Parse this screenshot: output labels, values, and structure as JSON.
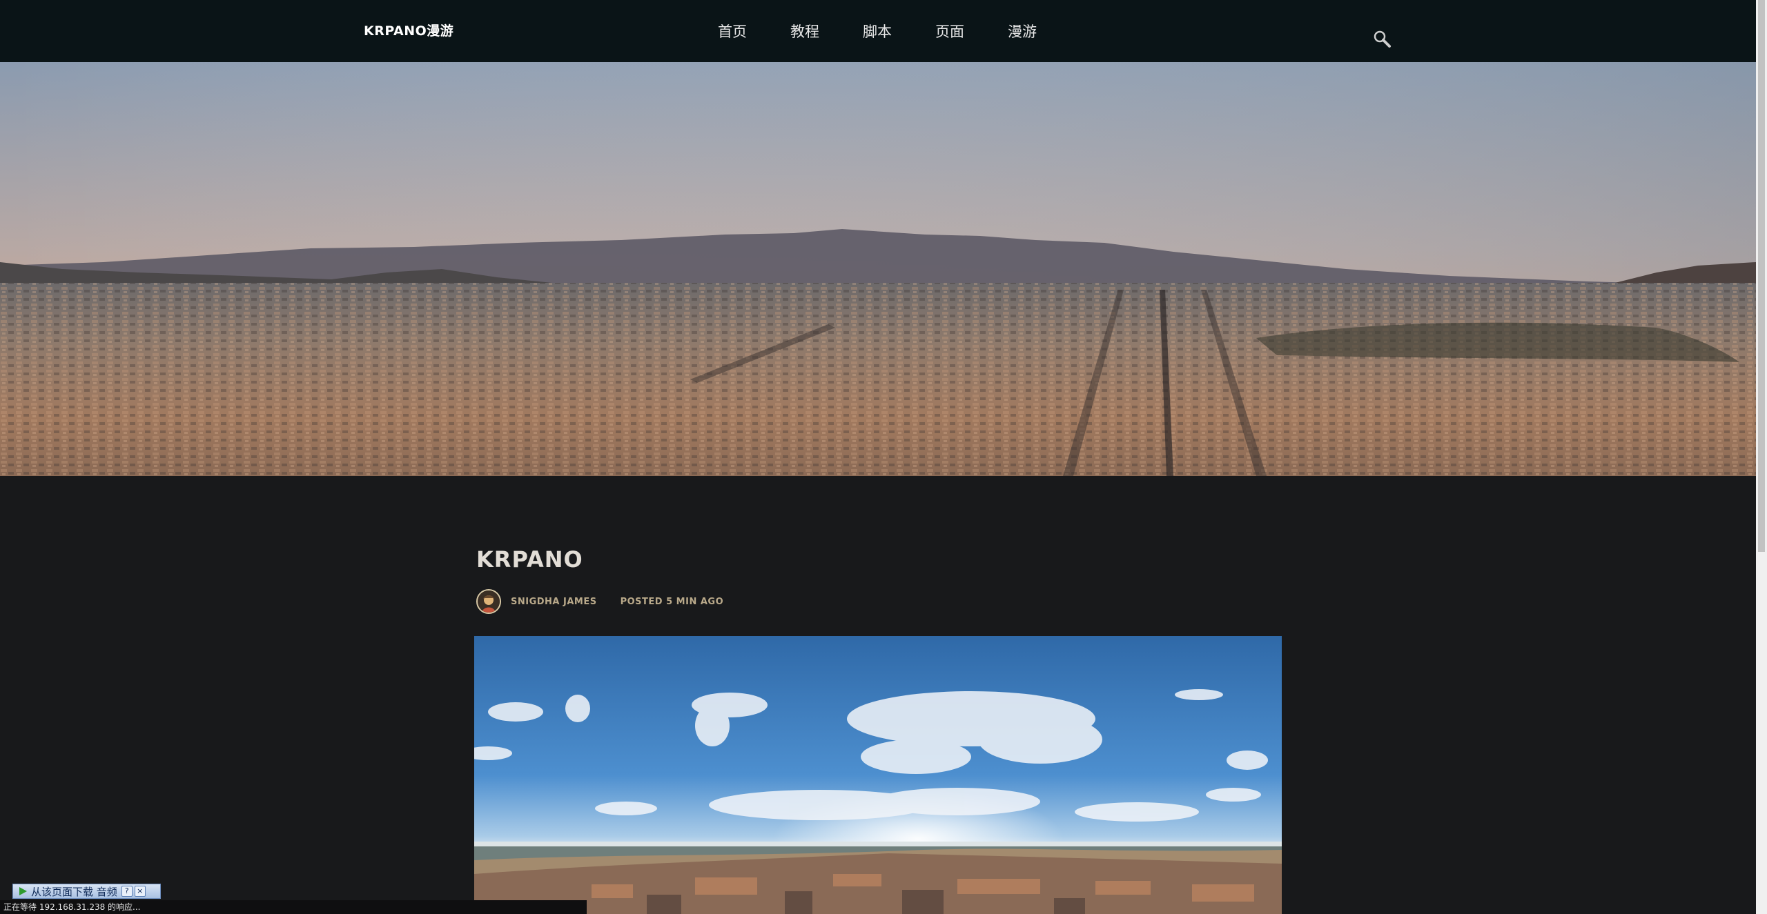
{
  "nav": {
    "logo": "KRPANO漫游",
    "items": [
      "首页",
      "教程",
      "脚本",
      "页面",
      "漫游"
    ],
    "search_icon": "search-icon"
  },
  "post": {
    "title": "KRPANO",
    "author": "SNIGDHA JAMES",
    "posted": "POSTED 5 MIN AGO"
  },
  "download_bar": {
    "label": "从该页面下载 音频",
    "help": "?",
    "close": "×"
  },
  "status_bar": {
    "text": "正在等待 192.168.31.238 的响应..."
  }
}
